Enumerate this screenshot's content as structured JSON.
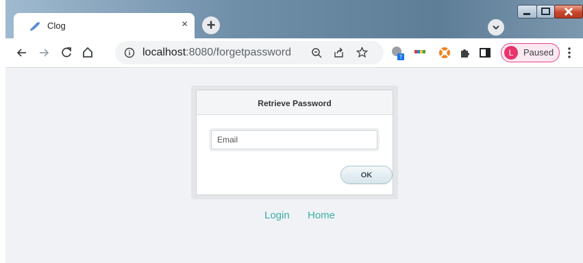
{
  "tab": {
    "title": "Clog",
    "close_glyph": "×",
    "favicon": "quill-icon"
  },
  "titlebar": {
    "new_tab_glyph": "+"
  },
  "address_bar": {
    "host": "localhost",
    "path": ":8080/forgetpassword"
  },
  "profile": {
    "initial": "L",
    "label": "Paused",
    "color": "#e8336e"
  },
  "dialog": {
    "title": "Retrieve Password",
    "email_placeholder": "Email",
    "email_value": "",
    "ok_label": "OK"
  },
  "links": {
    "login": "Login",
    "home": "Home"
  },
  "colors": {
    "link": "#3aaea4",
    "accent_pill": "#e6408a"
  }
}
